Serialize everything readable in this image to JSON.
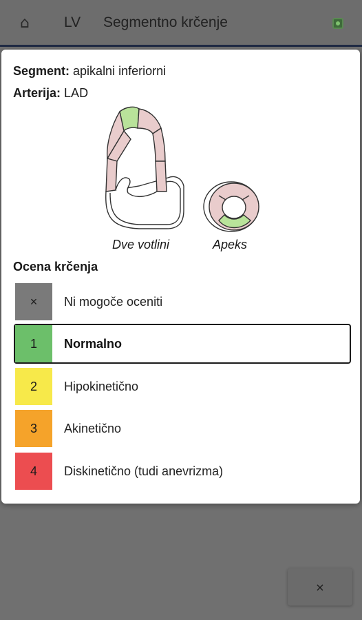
{
  "appbar": {
    "home_icon": "home-icon",
    "section": "LV",
    "title": "Segmentno krčenje",
    "status_icon": "status-icon"
  },
  "dialog": {
    "segment_label": "Segment:",
    "segment_value": "apikalni inferiorni",
    "artery_label": "Arterija:",
    "artery_value": "LAD",
    "diagram_caption_two_chamber": "Dve votlini",
    "diagram_caption_apex": "Apeks",
    "rating_title": "Ocena krčenja",
    "highlight_color": "#b9e39a",
    "segment_color": "#e9cccc",
    "options": [
      {
        "code": "×",
        "label": "Ni mogoče oceniti",
        "color": "#7a7a7a",
        "selected": false
      },
      {
        "code": "1",
        "label": "Normalno",
        "color": "#6cbf6a",
        "selected": true
      },
      {
        "code": "2",
        "label": "Hipokinetično",
        "color": "#f7e94a",
        "selected": false
      },
      {
        "code": "3",
        "label": "Akinetično",
        "color": "#f5a32a",
        "selected": false
      },
      {
        "code": "4",
        "label": "Diskinetično (tudi anevrizma)",
        "color": "#ec4d50",
        "selected": false
      }
    ]
  },
  "close_button": {
    "label": "×"
  }
}
